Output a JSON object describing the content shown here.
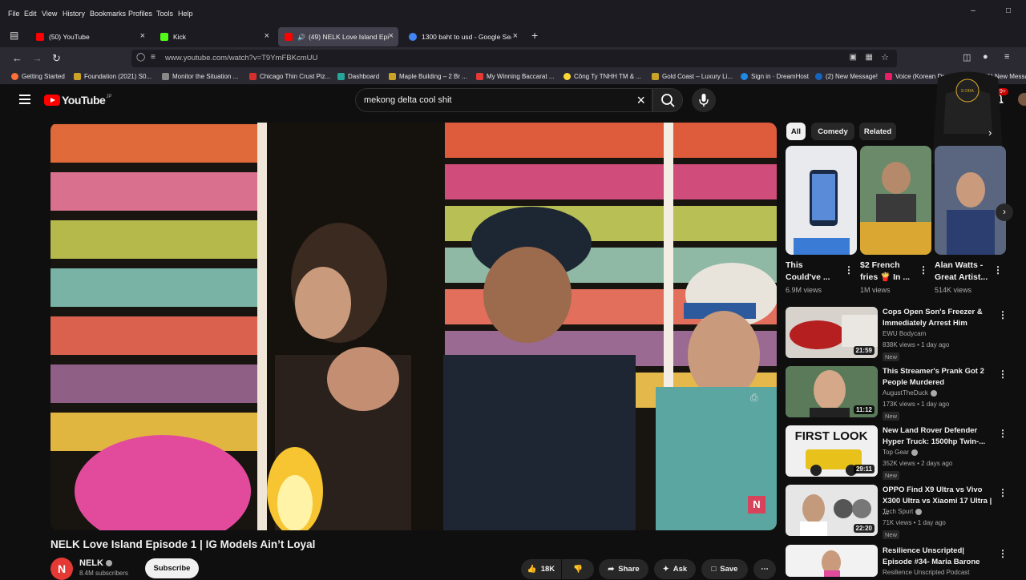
{
  "menubar": {
    "items": [
      "File",
      "Edit",
      "View",
      "History",
      "Bookmarks",
      "Profiles",
      "Tools",
      "Help"
    ]
  },
  "tabs": [
    {
      "label": "(50) YouTube",
      "color": "#ff0000"
    },
    {
      "label": "Kick",
      "color": "#53fc18"
    },
    {
      "label": "(49) NELK Love Island Episo",
      "color": "#ff0000"
    },
    {
      "label": "1300 baht to usd - Google Sear",
      "color": "#4285f4"
    }
  ],
  "url": "www.youtube.com/watch?v=T9YmFBKcmUU",
  "bookmarks": [
    {
      "label": "Getting Started",
      "color": "#ff7139"
    },
    {
      "label": "Foundation (2021) S0...",
      "color": "#c9a227"
    },
    {
      "label": "Monitor the Situation ...",
      "color": "#888888"
    },
    {
      "label": "Chicago Thin Crust Piz...",
      "color": "#d32f2f"
    },
    {
      "label": "Dashboard",
      "color": "#26a69a"
    },
    {
      "label": "Maple Building – 2 Br ...",
      "color": "#c9a227"
    },
    {
      "label": "My Winning Baccarat ...",
      "color": "#e53935"
    },
    {
      "label": "Công Ty TNHH TM & ...",
      "color": "#fdd835"
    },
    {
      "label": "Gold Coast – Luxury Li...",
      "color": "#c9a227"
    },
    {
      "label": "Sign in · DreamHost",
      "color": "#1e88e5"
    },
    {
      "label": "(2) New Message!",
      "color": "#1565c0"
    },
    {
      "label": "Voice (Korean Dr",
      "color": "#e91e63"
    },
    {
      "label": "(1) New Messa",
      "color": "#1565c0"
    }
  ],
  "youtube": {
    "logo_text": "YouTube",
    "country": "JP",
    "search_value": "mekong delta cool shit",
    "notif_count": "9+"
  },
  "video": {
    "title": "NELK Love Island Episode 1 | IG Models Ain’t Loyal",
    "channel": "NELK",
    "channel_initial": "N",
    "subscribers": "8.4M subscribers",
    "subscribe_label": "Subscribe",
    "likes": "18K",
    "share_label": "Share",
    "ask_label": "Ask",
    "save_label": "Save",
    "watermark": "N"
  },
  "chips": [
    "All",
    "Comedy",
    "Related"
  ],
  "shorts": [
    {
      "title": "This Could've ...",
      "views": "6.9M views"
    },
    {
      "title": "$2 French fries 🍟 In ...",
      "views": "1M views"
    },
    {
      "title": "Alan Watts - Great Artist...",
      "views": "514K views"
    }
  ],
  "recs": [
    {
      "title": "Cops Open Son's Freezer & Immediately Arrest Him",
      "channel": "EWU Bodycam",
      "meta": "838K views • 1 day ago",
      "duration": "21:59",
      "badge": "New",
      "verified": false
    },
    {
      "title": "This Streamer's Prank Got 2 People Murdered",
      "channel": "AugustTheDuck",
      "meta": "173K views • 1 day ago",
      "duration": "11:12",
      "badge": "New",
      "verified": true
    },
    {
      "title": "New Land Rover Defender Hyper Truck: 1500hp Twin-...",
      "channel": "Top Gear",
      "meta": "352K views • 2 days ago",
      "duration": "29:11",
      "badge": "New",
      "verified": true,
      "thumb_text": "FIRST LOOK"
    },
    {
      "title": "OPPO Find X9 Ultra vs Vivo X300 Ultra vs Xiaomi 17 Ultra | ...",
      "channel": "Tech Spurt",
      "meta": "71K views • 1 day ago",
      "duration": "22:20",
      "badge": "New",
      "verified": true
    },
    {
      "title": "Resilience Unscripted| Episode #34- Maria Barone",
      "channel": "Resilience Unscripted Podcast",
      "meta": "",
      "duration": "",
      "badge": "",
      "verified": false
    }
  ],
  "overlay": {
    "logo_text": "E-DRA"
  }
}
